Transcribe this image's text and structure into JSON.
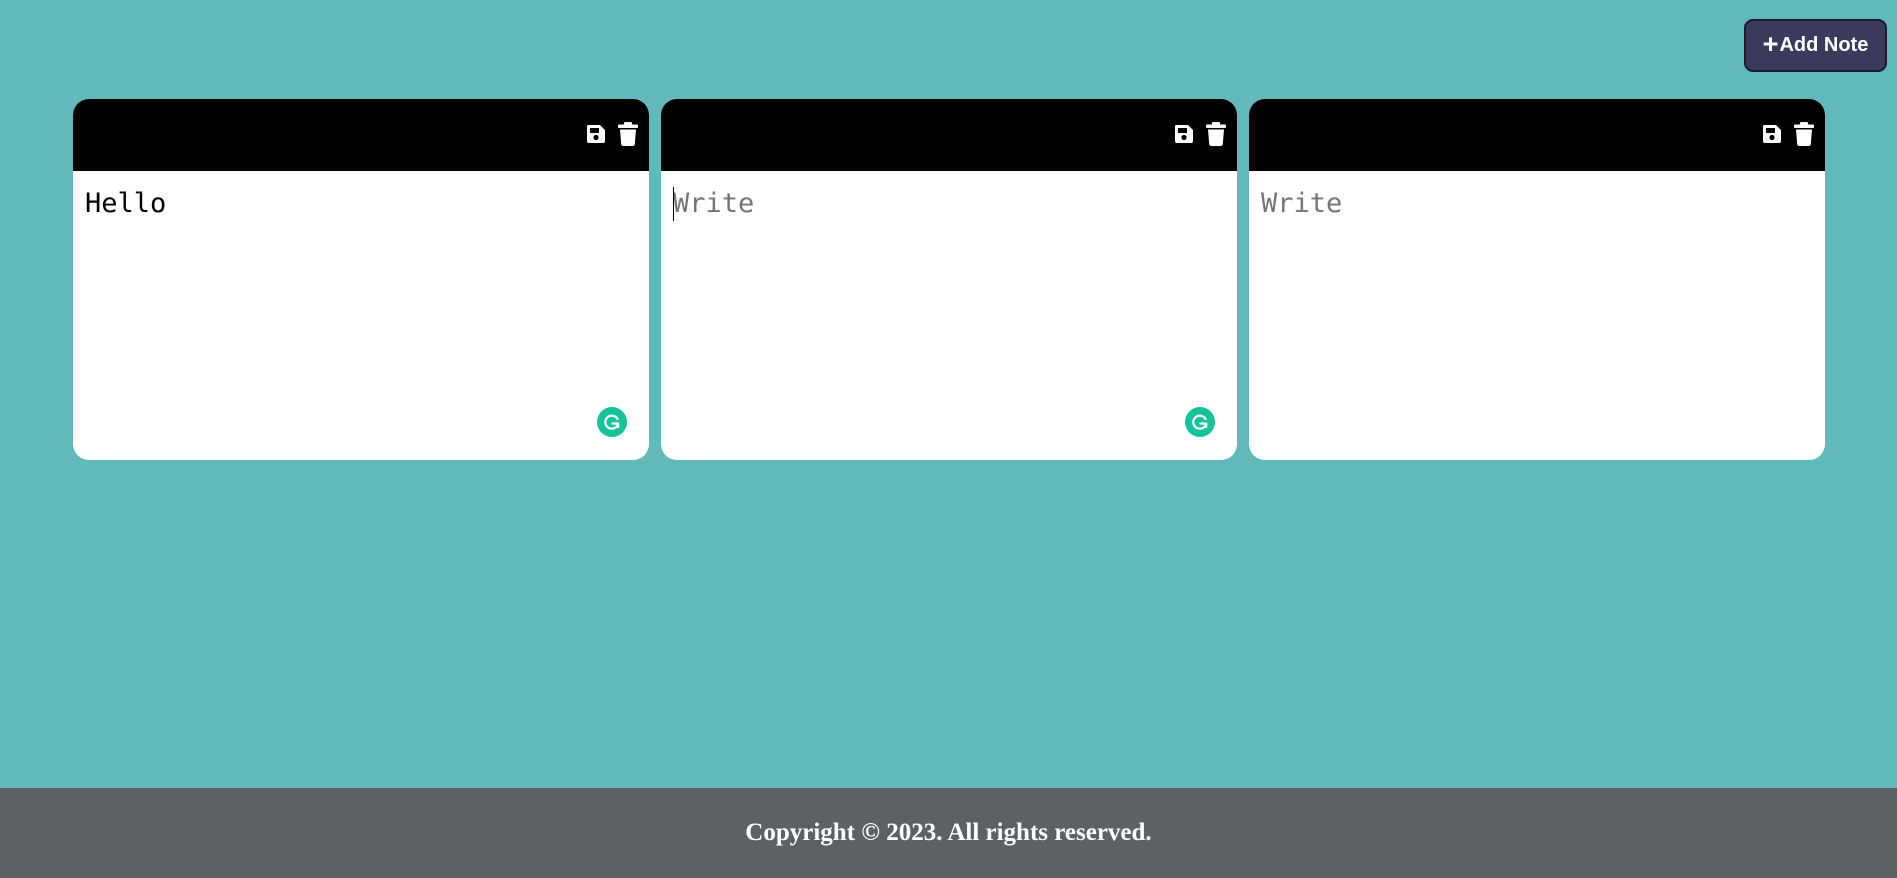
{
  "toolbar": {
    "add_note_icon": "+",
    "add_note_label": "Add Note"
  },
  "notes": [
    {
      "text": "Hello",
      "placeholder": "Write",
      "icons": [
        "save-icon",
        "trash-icon",
        "grammarly-icon"
      ]
    },
    {
      "text": "",
      "placeholder": "Write",
      "icons": [
        "save-icon",
        "trash-icon",
        "grammarly-icon"
      ]
    },
    {
      "text": "",
      "placeholder": "Write",
      "icons": [
        "save-icon",
        "trash-icon"
      ]
    }
  ],
  "footer": {
    "copyright": "Copyright © 2023. All rights reserved."
  },
  "colors": {
    "background": "#62b9b9",
    "button": "#3a3a5c",
    "note_header": "#000000",
    "grammarly": "#15c39a",
    "footer": "#5c6163"
  }
}
